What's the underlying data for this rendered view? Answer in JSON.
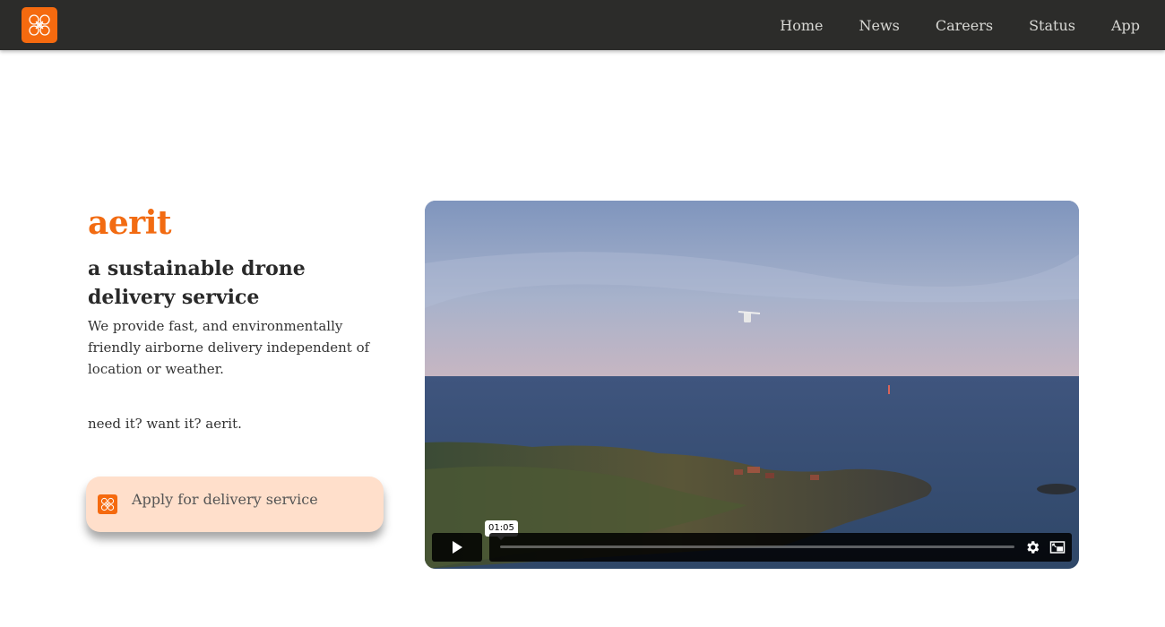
{
  "nav": {
    "logo_icon": "drone-logo-icon",
    "links": [
      "Home",
      "News",
      "Careers",
      "Status",
      "App"
    ]
  },
  "hero": {
    "brand": "aerit",
    "tagline": "a sustainable drone delivery service",
    "description": "We provide fast, and environmentally friendly airborne delivery independent of location or weather.",
    "slogan": "need it? want it? aerit.",
    "cta_label": "Apply for delivery service"
  },
  "video": {
    "time_tooltip": "01:05",
    "progress": 0,
    "controls": [
      "play-icon",
      "gear-icon",
      "picture-in-picture-icon"
    ]
  },
  "colors": {
    "brand_orange": "#f26b12",
    "navbar_bg": "#2c2c2a",
    "cta_bg": "#ffdfcb"
  }
}
